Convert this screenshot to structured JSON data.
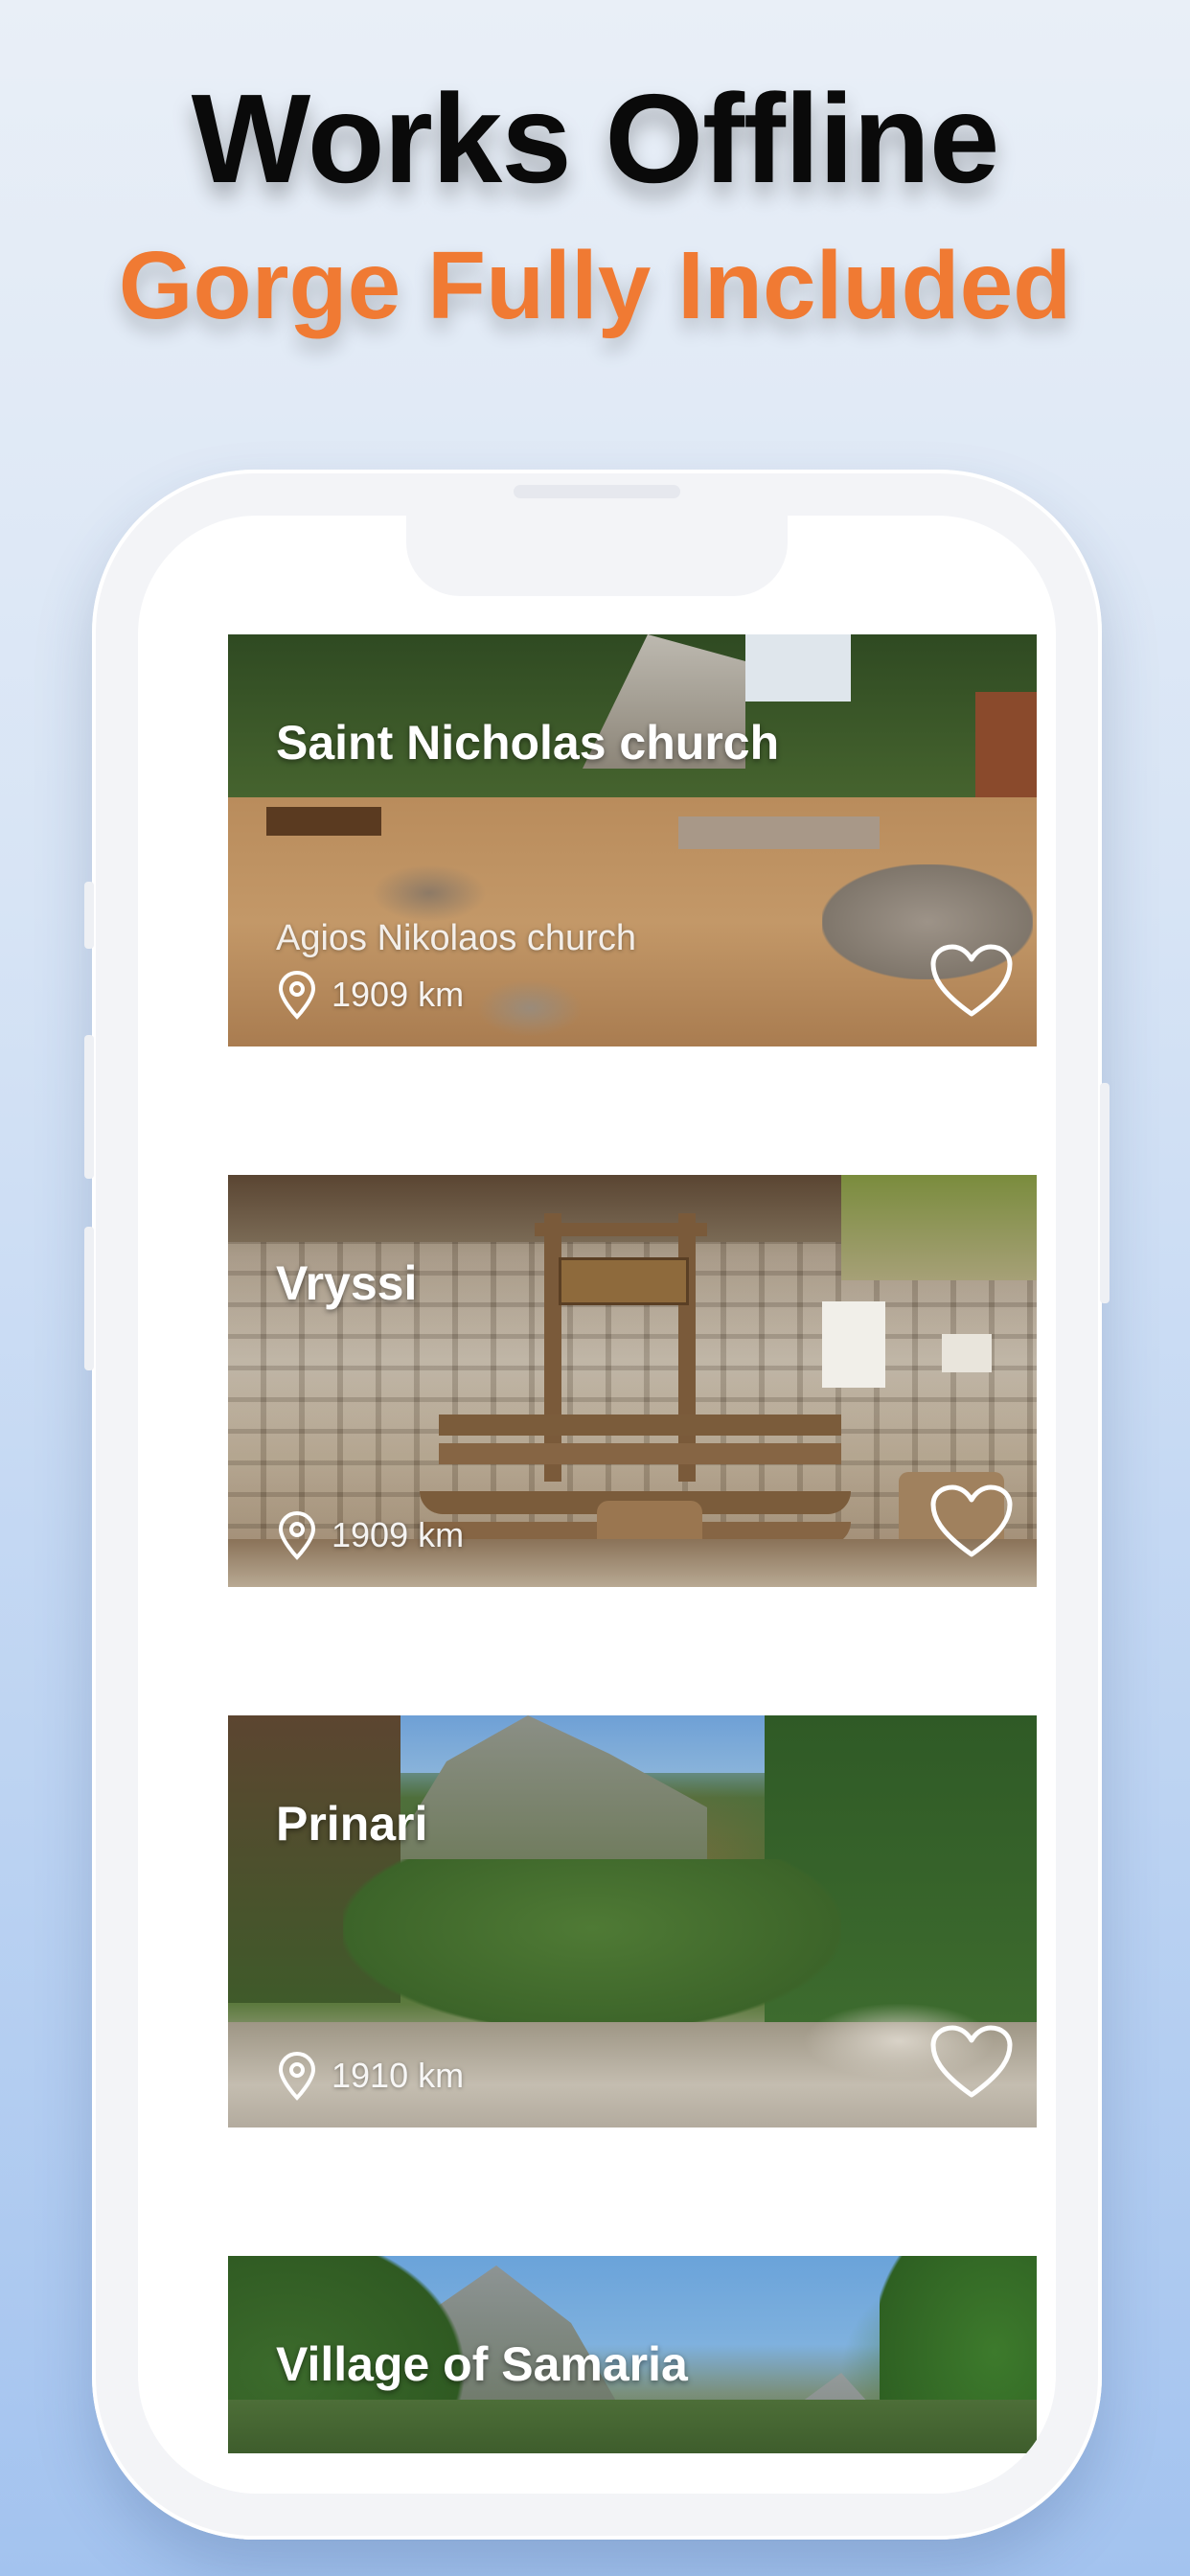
{
  "header": {
    "title": "Works Offline",
    "subtitle": "Gorge Fully Included"
  },
  "colors": {
    "accent": "#f07a33",
    "title": "#0a0a0a"
  },
  "places": [
    {
      "name": "Saint Nicholas church",
      "alt_name": "Agios Nikolaos church",
      "distance": "1909 km",
      "favorite": false
    },
    {
      "name": "Vryssi",
      "alt_name": "",
      "distance": "1909 km",
      "favorite": false
    },
    {
      "name": "Prinari",
      "alt_name": "",
      "distance": "1910 km",
      "favorite": false
    },
    {
      "name": "Village of Samaria",
      "alt_name": "",
      "distance": "",
      "favorite": false
    }
  ],
  "icons": {
    "location": "map-pin-icon",
    "favorite": "heart-outline-icon"
  }
}
